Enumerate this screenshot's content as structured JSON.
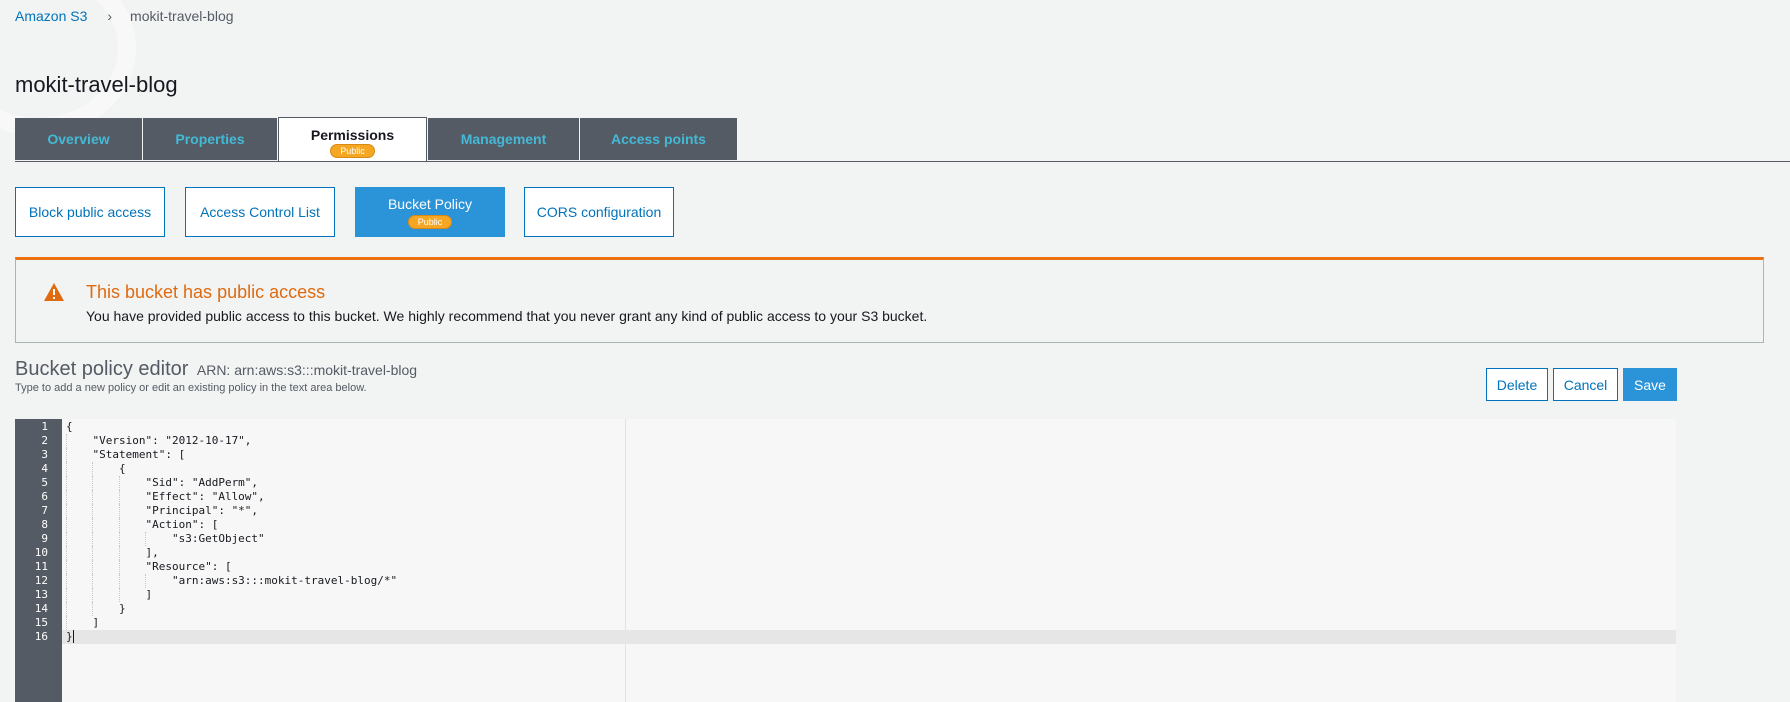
{
  "breadcrumb": {
    "root": "Amazon S3",
    "separator": "›",
    "current": "mokit-travel-blog"
  },
  "page_title": "mokit-travel-blog",
  "tabs": [
    {
      "label": "Overview"
    },
    {
      "label": "Properties"
    },
    {
      "label": "Permissions",
      "badge": "Public",
      "active": true
    },
    {
      "label": "Management"
    },
    {
      "label": "Access points"
    }
  ],
  "subtabs": [
    {
      "label": "Block public access"
    },
    {
      "label": "Access Control List"
    },
    {
      "label": "Bucket Policy",
      "badge": "Public",
      "active": true
    },
    {
      "label": "CORS configuration"
    }
  ],
  "alert": {
    "icon": "warning-icon",
    "title": "This bucket has public access",
    "body": "You have provided public access to this bucket. We highly recommend that you never grant any kind of public access to your S3 bucket."
  },
  "editor": {
    "title": "Bucket policy editor",
    "arn": "ARN: arn:aws:s3:::mokit-travel-blog",
    "subtitle": "Type to add a new policy or edit an existing policy in the text area below.",
    "buttons": {
      "delete": "Delete",
      "cancel": "Cancel",
      "save": "Save"
    },
    "active_line": 16,
    "lines": [
      "{",
      "    \"Version\": \"2012-10-17\",",
      "    \"Statement\": [",
      "        {",
      "            \"Sid\": \"AddPerm\",",
      "            \"Effect\": \"Allow\",",
      "            \"Principal\": \"*\",",
      "            \"Action\": [",
      "                \"s3:GetObject\"",
      "            ],",
      "            \"Resource\": [",
      "                \"arn:aws:s3:::mokit-travel-blog/*\"",
      "            ]",
      "        }",
      "    ]",
      "}"
    ]
  },
  "colors": {
    "accent": "#0073bb",
    "tab_bg": "#545b64",
    "tab_text": "#44b9d6",
    "warning": "#ec7211",
    "badge": "#f5a623"
  }
}
